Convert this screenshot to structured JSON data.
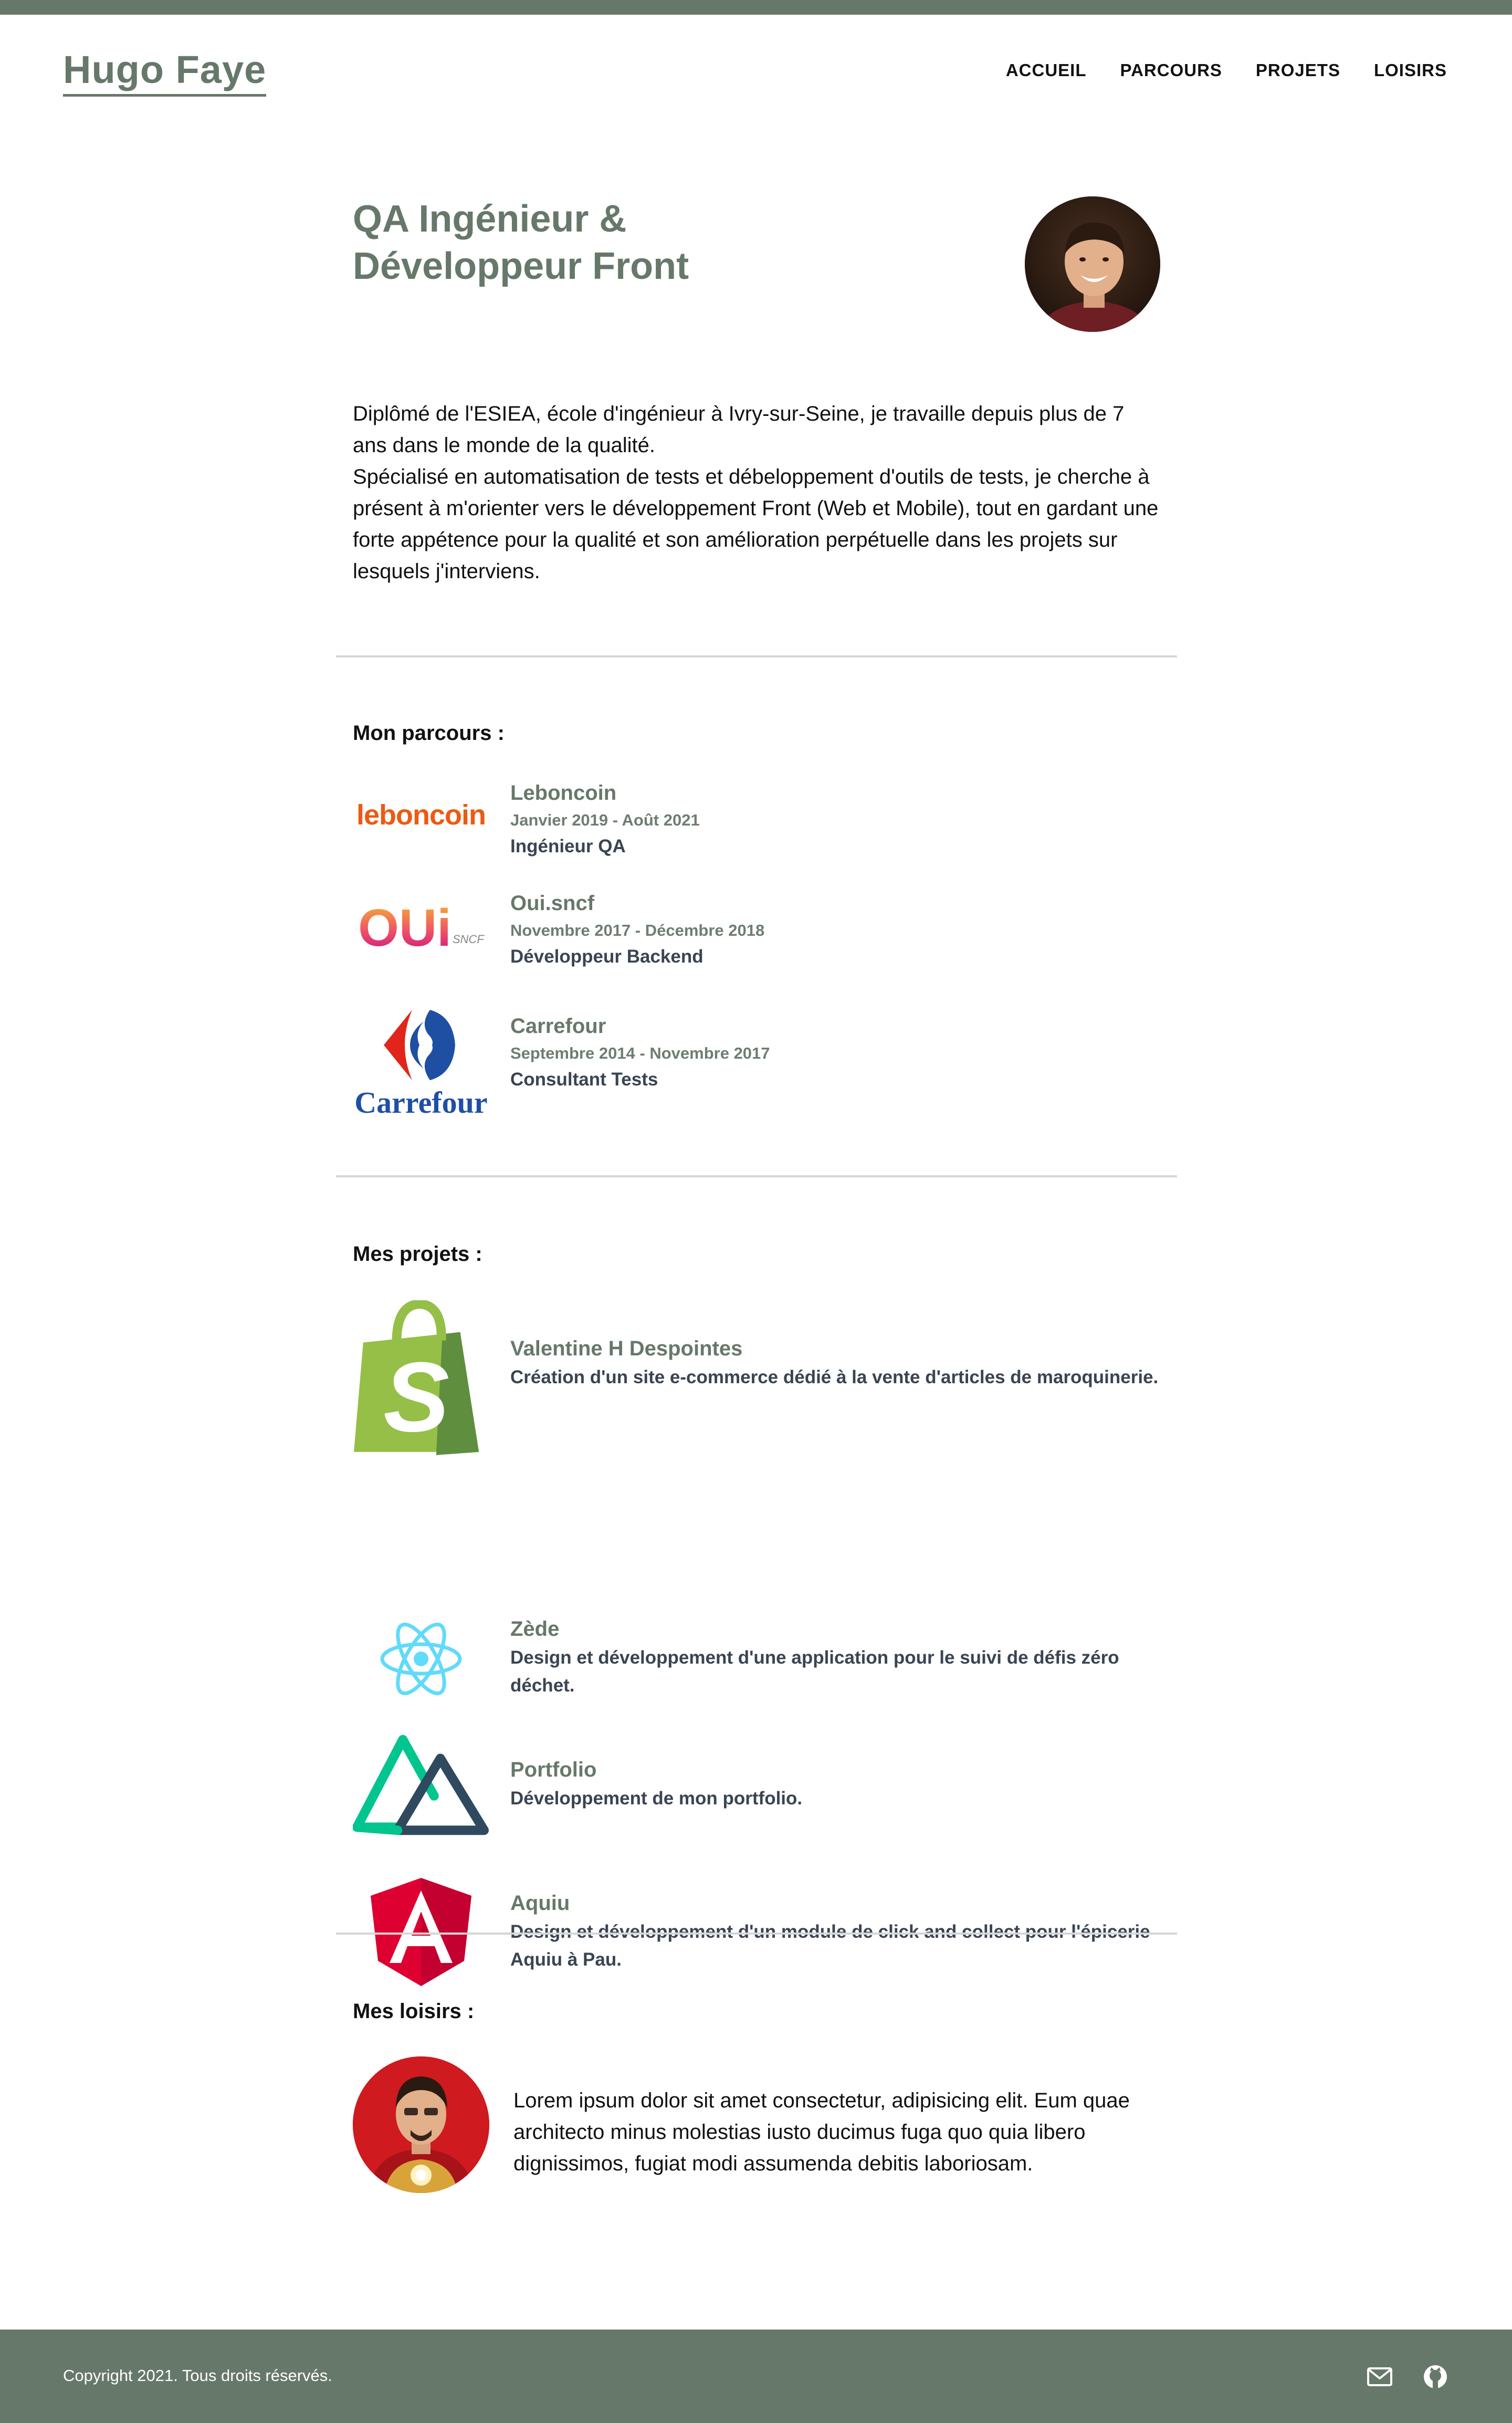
{
  "header": {
    "brand": "Hugo Faye",
    "nav": [
      {
        "label": "ACCUEIL"
      },
      {
        "label": "PARCOURS"
      },
      {
        "label": "PROJETS"
      },
      {
        "label": "LOISIRS"
      }
    ]
  },
  "hero": {
    "title_line1": "QA Ingénieur &",
    "title_line2": "Développeur Front"
  },
  "intro": {
    "p1": "Diplômé de l'ESIEA, école d'ingénieur à Ivry-sur-Seine, je travaille depuis plus de 7 ans dans le monde de la qualité.",
    "p2": "Spécialisé en automatisation de tests et débeloppement d'outils de tests, je cherche à présent à m'orienter vers le développement Front (Web et Mobile), tout en gardant une forte appétence pour la qualité et son amélioration perpétuelle dans les projets sur lesquels j'interviens."
  },
  "parcours": {
    "title": "Mon parcours :",
    "items": [
      {
        "name": "Leboncoin",
        "dates": "Janvier 2019 - Août 2021",
        "role": "Ingénieur QA",
        "logo_text": "leboncoin"
      },
      {
        "name": "Oui.sncf",
        "dates": "Novembre 2017 - Décembre 2018",
        "role": "Développeur Backend",
        "logo_text": "OUi",
        "logo_sub": "SNCF"
      },
      {
        "name": "Carrefour",
        "dates": "Septembre 2014 - Novembre 2017",
        "role": "Consultant Tests",
        "logo_text": "Carrefour"
      }
    ]
  },
  "projets": {
    "title": "Mes projets :",
    "items": [
      {
        "name": "Valentine H Despointes",
        "desc": "Création d'un site e-commerce dédié à la vente d'articles de maroquinerie.",
        "icon": "shopify-icon"
      },
      {
        "name": "Zède",
        "desc": "Design et développement d'une application pour le suivi de défis zéro déchet.",
        "icon": "react-icon"
      },
      {
        "name": "Portfolio",
        "desc": "Développement de mon portfolio.",
        "icon": "nuxt-icon"
      },
      {
        "name": "Aquiu",
        "desc": "Design et développement d'un module de click and collect pour l'épicerie Aquiu à Pau.",
        "icon": "angular-icon"
      }
    ]
  },
  "loisirs": {
    "title": "Mes loisirs :",
    "text": "Lorem ipsum dolor sit amet consectetur, adipisicing elit. Eum quae architecto minus molestias iusto ducimus fuga quo quia libero dignissimos, fugiat modi assumenda debitis laboriosam."
  },
  "footer": {
    "copyright": "Copyright 2021. Tous droits réservés.",
    "icons": [
      "mail-icon",
      "github-icon"
    ]
  },
  "colors": {
    "accent": "#66786a",
    "text_dark": "#3a4452",
    "divider": "#d6d6d6"
  }
}
